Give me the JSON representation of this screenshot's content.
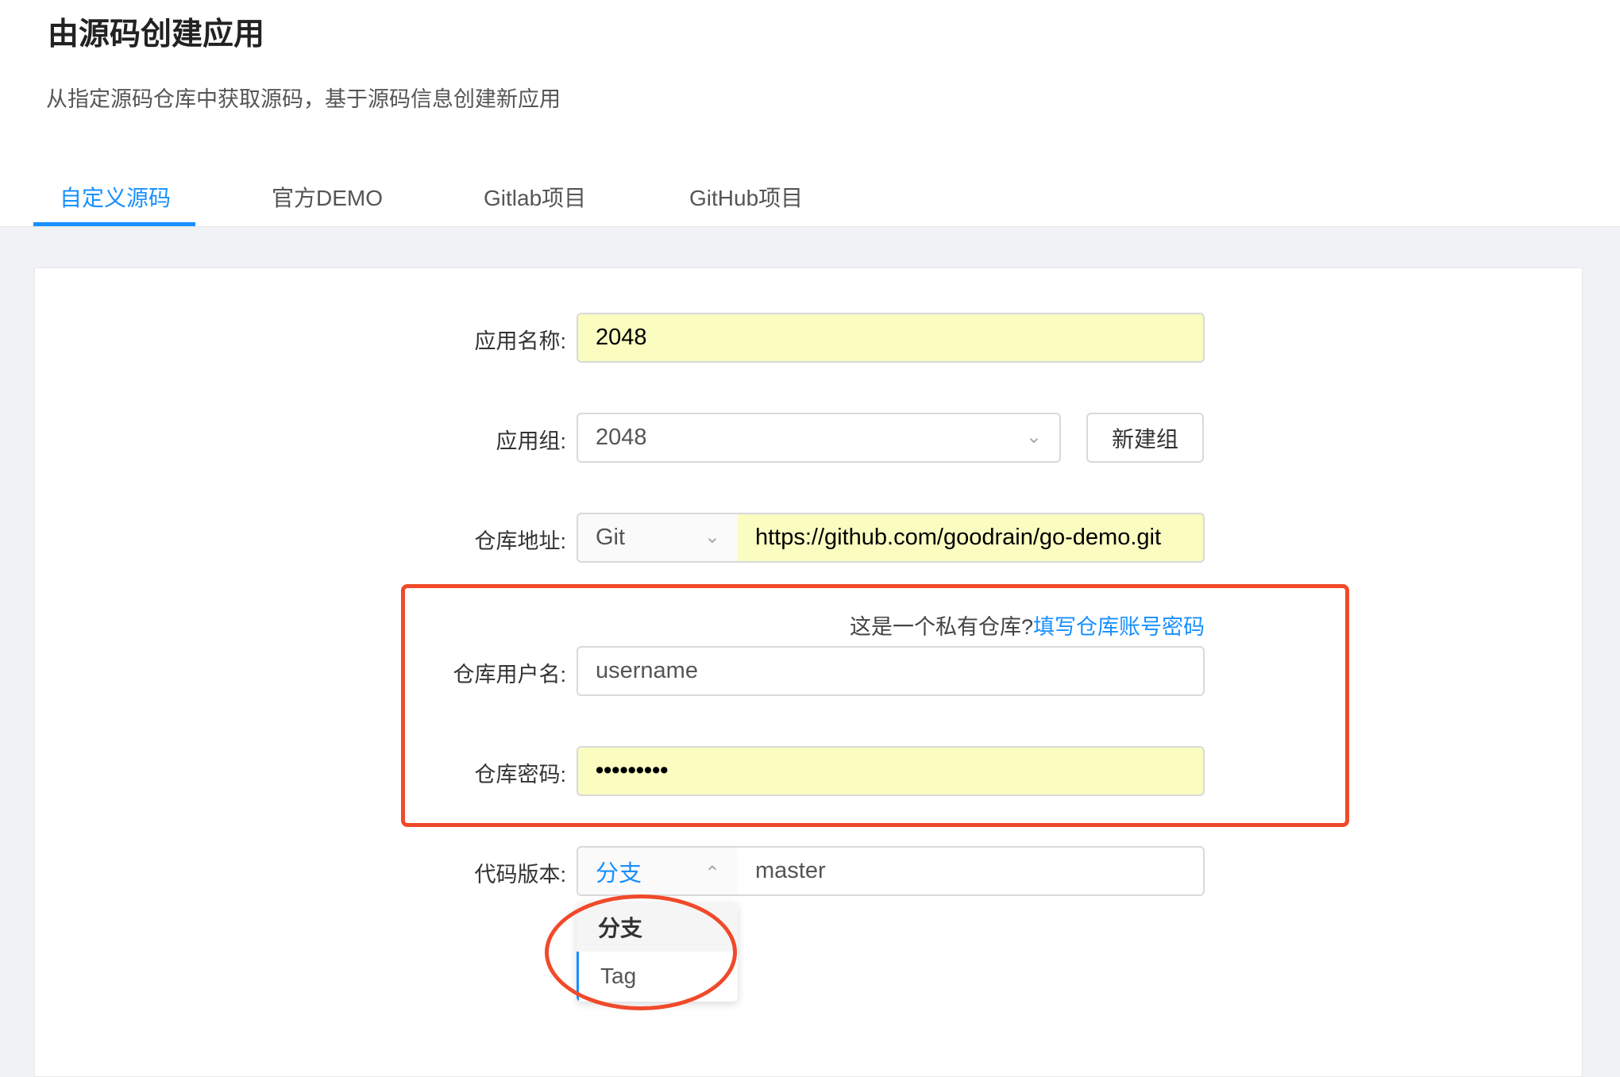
{
  "header": {
    "title": "由源码创建应用",
    "subtitle": "从指定源码仓库中获取源码，基于源码信息创建新应用"
  },
  "tabs": [
    {
      "label": "自定义源码",
      "active": true
    },
    {
      "label": "官方DEMO"
    },
    {
      "label": "Gitlab项目"
    },
    {
      "label": "GitHub项目"
    }
  ],
  "form": {
    "app_name": {
      "label": "应用名称:",
      "value": "2048"
    },
    "app_group": {
      "label": "应用组:",
      "value": "2048",
      "new_group_button": "新建组"
    },
    "repo": {
      "label": "仓库地址:",
      "type": "Git",
      "url": "https://github.com/goodrain/go-demo.git"
    },
    "private_hint": {
      "text": "这是一个私有仓库?",
      "link": "填写仓库账号密码"
    },
    "username": {
      "label": "仓库用户名:",
      "placeholder": "username"
    },
    "password": {
      "label": "仓库密码:",
      "value": "•••••••••"
    },
    "version": {
      "label": "代码版本:",
      "type": "分支",
      "value": "master",
      "options": [
        "分支",
        "Tag"
      ]
    }
  },
  "colors": {
    "accent": "#1890ff",
    "annotation": "#f04a2a",
    "autofill": "#fafcc0"
  }
}
